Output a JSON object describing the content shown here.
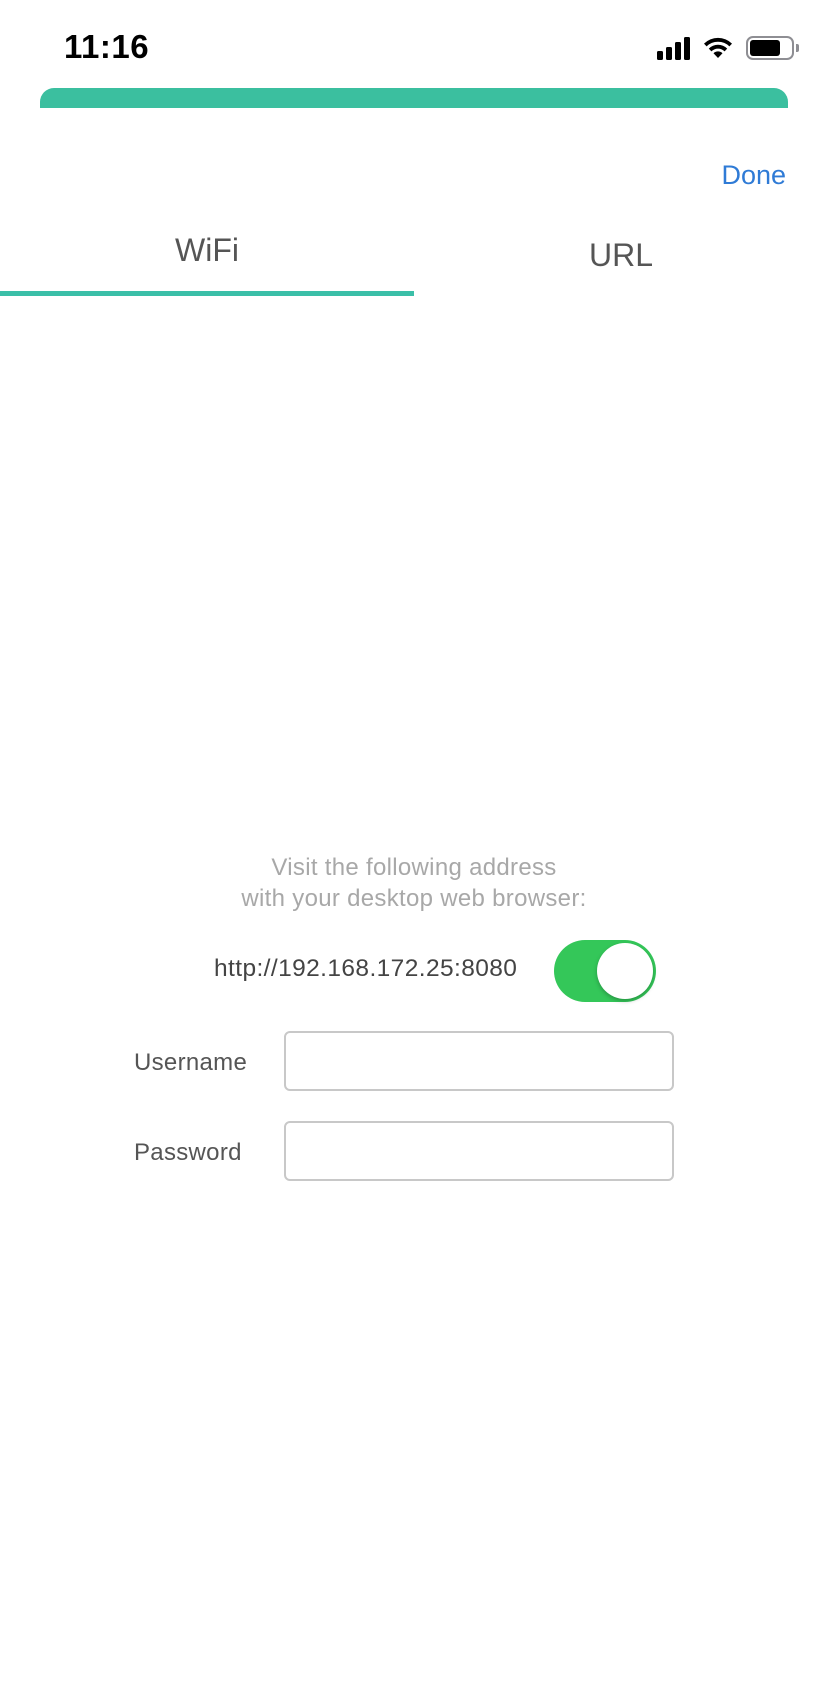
{
  "status_bar": {
    "time": "11:16",
    "icons": [
      "signal-icon",
      "wifi-icon",
      "battery-icon"
    ]
  },
  "header": {
    "done_label": "Done"
  },
  "tabs": [
    {
      "label": "WiFi",
      "selected": true
    },
    {
      "label": "URL",
      "selected": false
    }
  ],
  "instructions": {
    "line1": "Visit the following address",
    "line2": "with your desktop web browser:"
  },
  "server": {
    "address": "http://192.168.172.25:8080",
    "enabled": true
  },
  "form": {
    "username_label": "Username",
    "username_value": "",
    "password_label": "Password",
    "password_value": ""
  },
  "colors": {
    "accent_teal": "#3bbf9f",
    "link_blue": "#2f7bd6",
    "toggle_on": "#34c759"
  }
}
